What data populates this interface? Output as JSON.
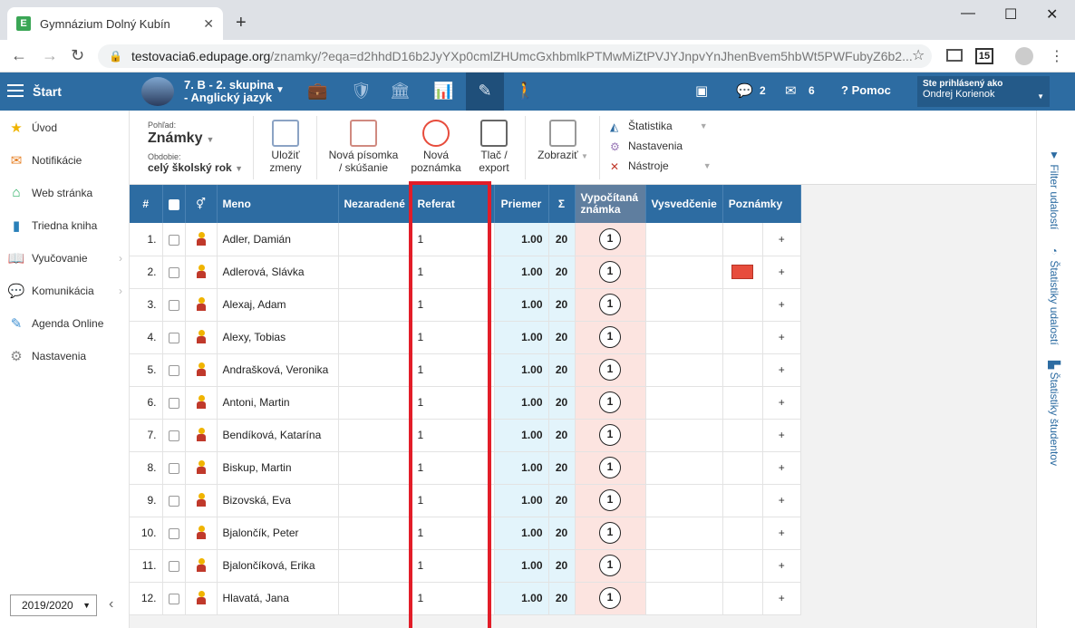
{
  "browser": {
    "tab_title": "Gymnázium Dolný Kubín",
    "favicon_letter": "E",
    "url_host": "testovacia6.edupage.org",
    "url_path": "/znamky/?eqa=d2hhdD16b2JyYXp0cmlZHUmcGxhbmlkPTMwMiZtPVJYJnpvYnJhenBvem5hbWt5PWFubyZ6b2...",
    "ext_badge": "15"
  },
  "appbar": {
    "start_label": "Štart",
    "class_line1": "7. B - 2. skupina",
    "class_line2": "- Anglický jazyk",
    "messages_count": "2",
    "mail_count": "6",
    "help_label": "Pomoc",
    "user_caption": "Ste prihlásený ako",
    "user_name": "Ondrej Korienok"
  },
  "sidebar": {
    "items": [
      {
        "label": "Úvod"
      },
      {
        "label": "Notifikácie"
      },
      {
        "label": "Web stránka"
      },
      {
        "label": "Triedna kniha"
      },
      {
        "label": "Vyučovanie"
      },
      {
        "label": "Komunikácia"
      },
      {
        "label": "Agenda Online"
      },
      {
        "label": "Nastavenia"
      }
    ],
    "year": "2019/2020"
  },
  "toolbar": {
    "view_caption": "Pohľad:",
    "view_value": "Známky",
    "period_caption": "Obdobie:",
    "period_value": "celý školský rok",
    "save_line1": "Uložiť",
    "save_line2": "zmeny",
    "new_test_line1": "Nová písomka",
    "new_test_line2": "/ skúšanie",
    "new_note_line1": "Nová",
    "new_note_line2": "poznámka",
    "print_line1": "Tlač /",
    "print_line2": "export",
    "show_label": "Zobraziť",
    "stats_label": "Štatistika",
    "settings_label": "Nastavenia",
    "tools_label": "Nástroje"
  },
  "rail": {
    "filter": "Filter udalostí",
    "event_stats": "Štatistiky udalostí",
    "student_stats": "Štatistiky študentov"
  },
  "table": {
    "headers": {
      "num": "#",
      "name": "Meno",
      "unassigned": "Nezaradené",
      "referat": "Referat",
      "average": "Priemer",
      "sum": "Σ",
      "calc_line1": "Vypočítaná",
      "calc_line2": "známka",
      "report": "Vysvedčenie",
      "notes": "Poznámky"
    },
    "rows": [
      {
        "num": "1.",
        "name": "Adler, Damián",
        "referat": "1",
        "average": "1.00",
        "sum": "20",
        "calc": "1",
        "note": false
      },
      {
        "num": "2.",
        "name": "Adlerová, Slávka",
        "referat": "1",
        "average": "1.00",
        "sum": "20",
        "calc": "1",
        "note": true
      },
      {
        "num": "3.",
        "name": "Alexaj, Adam",
        "referat": "1",
        "average": "1.00",
        "sum": "20",
        "calc": "1",
        "note": false
      },
      {
        "num": "4.",
        "name": "Alexy, Tobias",
        "referat": "1",
        "average": "1.00",
        "sum": "20",
        "calc": "1",
        "note": false
      },
      {
        "num": "5.",
        "name": "Andrašková, Veronika",
        "referat": "1",
        "average": "1.00",
        "sum": "20",
        "calc": "1",
        "note": false
      },
      {
        "num": "6.",
        "name": "Antoni, Martin",
        "referat": "1",
        "average": "1.00",
        "sum": "20",
        "calc": "1",
        "note": false
      },
      {
        "num": "7.",
        "name": "Bendíková, Katarína",
        "referat": "1",
        "average": "1.00",
        "sum": "20",
        "calc": "1",
        "note": false
      },
      {
        "num": "8.",
        "name": "Biskup, Martin",
        "referat": "1",
        "average": "1.00",
        "sum": "20",
        "calc": "1",
        "note": false
      },
      {
        "num": "9.",
        "name": "Bizovská, Eva",
        "referat": "1",
        "average": "1.00",
        "sum": "20",
        "calc": "1",
        "note": false
      },
      {
        "num": "10.",
        "name": "Bjalončík, Peter",
        "referat": "1",
        "average": "1.00",
        "sum": "20",
        "calc": "1",
        "note": false
      },
      {
        "num": "11.",
        "name": "Bjalončíková, Erika",
        "referat": "1",
        "average": "1.00",
        "sum": "20",
        "calc": "1",
        "note": false
      },
      {
        "num": "12.",
        "name": "Hlavatá, Jana",
        "referat": "1",
        "average": "1.00",
        "sum": "20",
        "calc": "1",
        "note": false
      }
    ]
  },
  "colors": {
    "brand_blue": "#2d6ca2",
    "highlight_red": "#e21d28",
    "avg_bg": "#e3f4fb",
    "calc_bg": "#fce4e0",
    "note_red": "#e74c3c"
  }
}
